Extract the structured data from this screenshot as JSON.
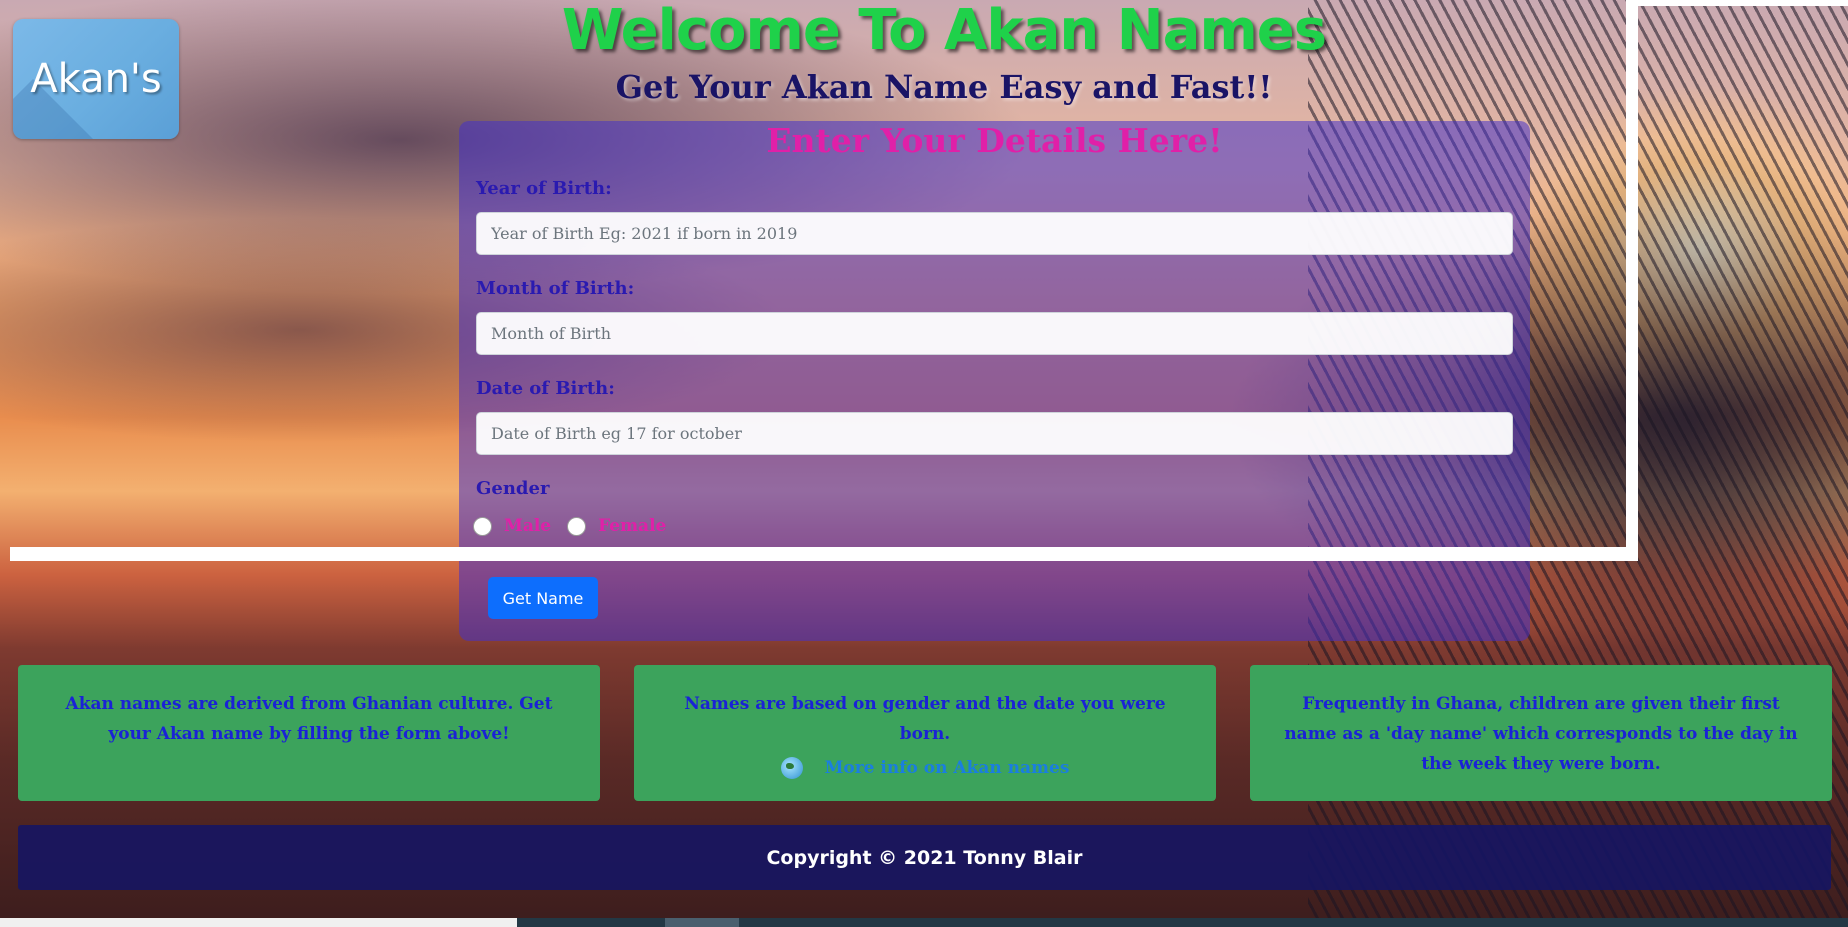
{
  "logo": {
    "text": "Akan's"
  },
  "header": {
    "title": "Welcome To Akan Names",
    "subtitle": "Get Your Akan Name Easy and Fast!!"
  },
  "form": {
    "heading": "Enter Your Details Here!",
    "year_label": "Year of Birth:",
    "year_placeholder": "Year of Birth Eg: 2021 if born in 2019",
    "month_label": "Month of Birth:",
    "month_placeholder": "Month of Birth",
    "date_label": "Date of Birth:",
    "date_placeholder": "Date of Birth eg 17 for october",
    "gender_label": "Gender",
    "gender_options": [
      "Male",
      "Female"
    ],
    "submit_label": "Get Name"
  },
  "info_boxes": {
    "box1": "Akan names are derived from Ghanian culture. Get your Akan name by filling the form above!",
    "box2": "Names are based on gender and the date you were born.",
    "box2_link": "More info on Akan names",
    "box3": "Frequently in Ghana, children are given their first name as a 'day name' which corresponds to the day in the week they were born."
  },
  "footer": {
    "text": "Copyright © 2021 Tonny Blair"
  },
  "colors": {
    "title_green": "#1fd14a",
    "heading_magenta": "#e020a8",
    "label_blue": "#2a1ab0",
    "info_green": "#3ca35c",
    "footer_navy": "#141464",
    "button_blue": "#0d6efd"
  }
}
